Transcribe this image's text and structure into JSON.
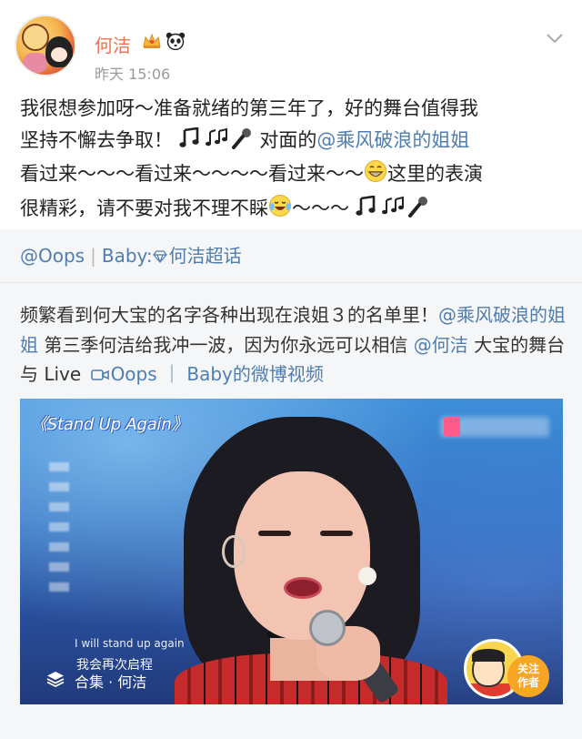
{
  "header": {
    "username": "何洁",
    "timestamp": "昨天 15:06",
    "badges": [
      "crown-icon",
      "panda-icon"
    ]
  },
  "post": {
    "line1": "我很想参加呀～准备就绪的第三年了，好的舞台值得我",
    "line2_a": "坚持不懈去争取！",
    "line2_b": "对面的",
    "line2_mention": "@乘风破浪的姐姐",
    "line3_a": "看过来～～～看过来～～～～看过来～～",
    "line3_b": "这里的表演",
    "line4_a": "很精彩，请不要对我不理不睬",
    "line4_b": "～～～"
  },
  "repost": {
    "author_a": "@Oops",
    "author_sep": "|",
    "author_b": "Baby:",
    "author_topic": "何洁超话",
    "text_a": "频繁看到何大宝的名字各种出现在浪姐３的名单里！",
    "text_mention1": "@乘风破浪的姐姐",
    "text_b": " 第三季何洁给我冲一波，因为你永远可以相信 ",
    "text_mention2": "@何洁",
    "text_c": " 大宝的舞台与 Live ",
    "text_video_link": "Oops ｜ Baby的微博视频"
  },
  "video": {
    "song_title": "《Stand Up Again》",
    "lyric_en": "I will stand up again",
    "lyric_cn": "我会再次启程",
    "collection_label": "合集 · 何洁",
    "follow_label": "关注\n作者"
  },
  "colors": {
    "username": "#eb7350",
    "link": "#507daf",
    "repost_bg": "#f5f6f7"
  }
}
